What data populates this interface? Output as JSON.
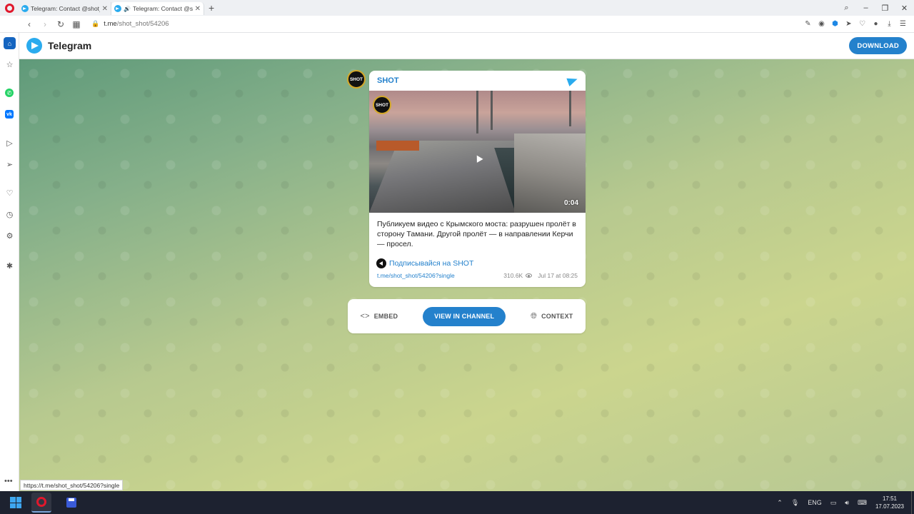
{
  "browser": {
    "tabs": [
      {
        "title": "Telegram: Contact @shot_",
        "active": false,
        "audio": false
      },
      {
        "title": "Telegram: Contact @sh",
        "active": true,
        "audio": true
      }
    ],
    "new_tab": "+",
    "url_host": "t.me",
    "url_path": "/shot_shot/54206",
    "status_url": "https://t.me/shot_shot/54206?single"
  },
  "telegram": {
    "brand": "Telegram",
    "download_label": "DOWNLOAD"
  },
  "post": {
    "channel": "SHOT",
    "avatar_text": "SHOT",
    "video_logo_text": "SHOT",
    "video_duration": "0:04",
    "text": "Публикуем видео с Крымского моста: разрушен пролёт в сторону Тамани. Другой пролёт — в направлении Керчи — просел.",
    "subscribe_label": "Подписывайся на SHOT",
    "link": "t.me/shot_shot/54206?single",
    "views": "310.6K",
    "date": "Jul 17 at 08:25"
  },
  "actions": {
    "embed": "EMBED",
    "view_in_channel": "VIEW IN CHANNEL",
    "context": "CONTEXT"
  },
  "taskbar": {
    "lang": "ENG",
    "time": "17:51",
    "date": "17.07.2023"
  },
  "colors": {
    "accent": "#2481cc",
    "telegram_blue": "#2aabee",
    "opera_red": "#e0182c"
  }
}
